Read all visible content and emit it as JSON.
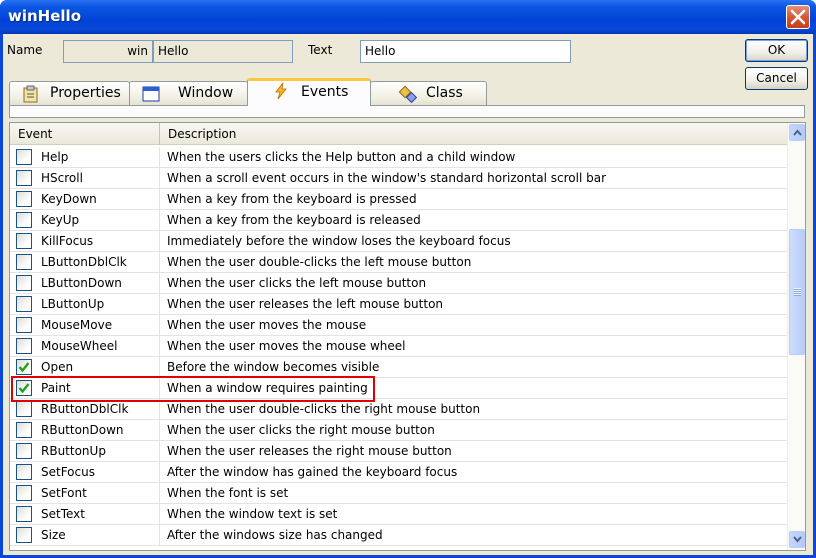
{
  "window": {
    "title": "winHello"
  },
  "form": {
    "name_label": "Name",
    "name_prefix": "win",
    "name_value": "Hello",
    "text_label": "Text",
    "text_value": "Hello"
  },
  "buttons": {
    "ok": "OK",
    "cancel": "Cancel"
  },
  "tabs": [
    {
      "label": "Properties",
      "icon": "properties-icon"
    },
    {
      "label": "Window",
      "icon": "window-icon"
    },
    {
      "label": "Events",
      "icon": "lightning-icon",
      "active": true
    },
    {
      "label": "Class",
      "icon": "class-icon"
    }
  ],
  "grid": {
    "columns": [
      "Event",
      "Description"
    ],
    "rows": [
      {
        "event": "Help",
        "description": "When the users clicks the Help button and a child window",
        "checked": false
      },
      {
        "event": "HScroll",
        "description": "When a scroll event occurs in the window's standard horizontal scroll bar",
        "checked": false
      },
      {
        "event": "KeyDown",
        "description": "When a key from the keyboard is pressed",
        "checked": false
      },
      {
        "event": "KeyUp",
        "description": "When a key from the keyboard is released",
        "checked": false
      },
      {
        "event": "KillFocus",
        "description": "Immediately before the window loses the keyboard focus",
        "checked": false
      },
      {
        "event": "LButtonDblClk",
        "description": "When the user double-clicks the left mouse button",
        "checked": false
      },
      {
        "event": "LButtonDown",
        "description": "When the user clicks the left mouse button",
        "checked": false
      },
      {
        "event": "LButtonUp",
        "description": "When the user releases the left mouse button",
        "checked": false
      },
      {
        "event": "MouseMove",
        "description": "When the user moves the mouse",
        "checked": false
      },
      {
        "event": "MouseWheel",
        "description": "When the user moves the mouse wheel",
        "checked": false
      },
      {
        "event": "Open",
        "description": "Before the window becomes visible",
        "checked": true
      },
      {
        "event": "Paint",
        "description": "When a window requires painting",
        "checked": true
      },
      {
        "event": "RButtonDblClk",
        "description": "When the user double-clicks the right mouse button",
        "checked": false
      },
      {
        "event": "RButtonDown",
        "description": "When the user clicks the right mouse button",
        "checked": false
      },
      {
        "event": "RButtonUp",
        "description": "When the user releases the right mouse button",
        "checked": false
      },
      {
        "event": "SetFocus",
        "description": "After the window has gained the keyboard focus",
        "checked": false
      },
      {
        "event": "SetFont",
        "description": "When the font is set",
        "checked": false
      },
      {
        "event": "SetText",
        "description": "When the window text is set",
        "checked": false
      },
      {
        "event": "Size",
        "description": "After the windows size has changed",
        "checked": false
      }
    ]
  },
  "colors": {
    "highlight_border": "#e00000",
    "titlebar": "#0054e3",
    "face": "#ece9d8"
  }
}
